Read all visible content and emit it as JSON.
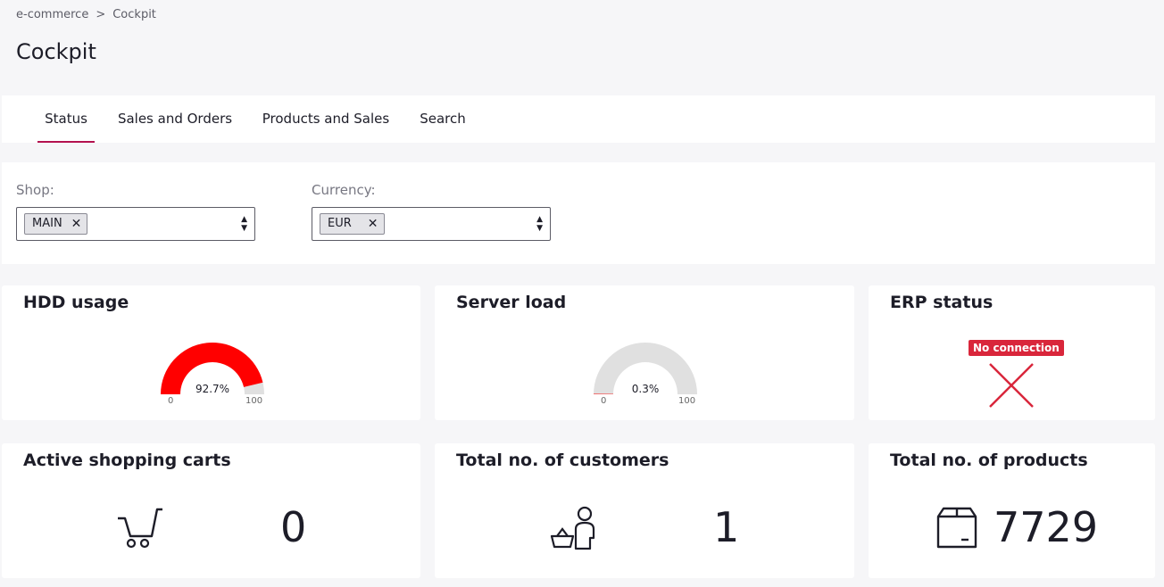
{
  "breadcrumb": {
    "parent": "e-commerce",
    "separator": ">",
    "current": "Cockpit"
  },
  "page_title": "Cockpit",
  "tabs": [
    {
      "label": "Status",
      "active": true
    },
    {
      "label": "Sales and Orders",
      "active": false
    },
    {
      "label": "Products and Sales",
      "active": false
    },
    {
      "label": "Search",
      "active": false
    }
  ],
  "filters": {
    "shop": {
      "label": "Shop:",
      "selected": "MAIN"
    },
    "currency": {
      "label": "Currency:",
      "selected": "EUR"
    }
  },
  "cards": {
    "hdd": {
      "title": "HDD usage",
      "value_label": "92.7%",
      "value": 92.7,
      "min": "0",
      "max": "100",
      "color": "#ff0000"
    },
    "server": {
      "title": "Server load",
      "value_label": "0.3%",
      "value": 0.3,
      "min": "0",
      "max": "100",
      "color": "#ff0000"
    },
    "erp": {
      "title": "ERP status",
      "badge": "No connection",
      "icon": "x-icon"
    },
    "carts": {
      "title": "Active shopping carts",
      "value": "0",
      "icon": "cart-icon"
    },
    "customers": {
      "title": "Total no. of customers",
      "value": "1",
      "icon": "customer-icon"
    },
    "products": {
      "title": "Total no. of products",
      "value": "7729",
      "icon": "box-icon"
    }
  },
  "colors": {
    "accent": "#b3124f",
    "error": "#d9263b",
    "gauge_track": "#e0e0e0"
  }
}
